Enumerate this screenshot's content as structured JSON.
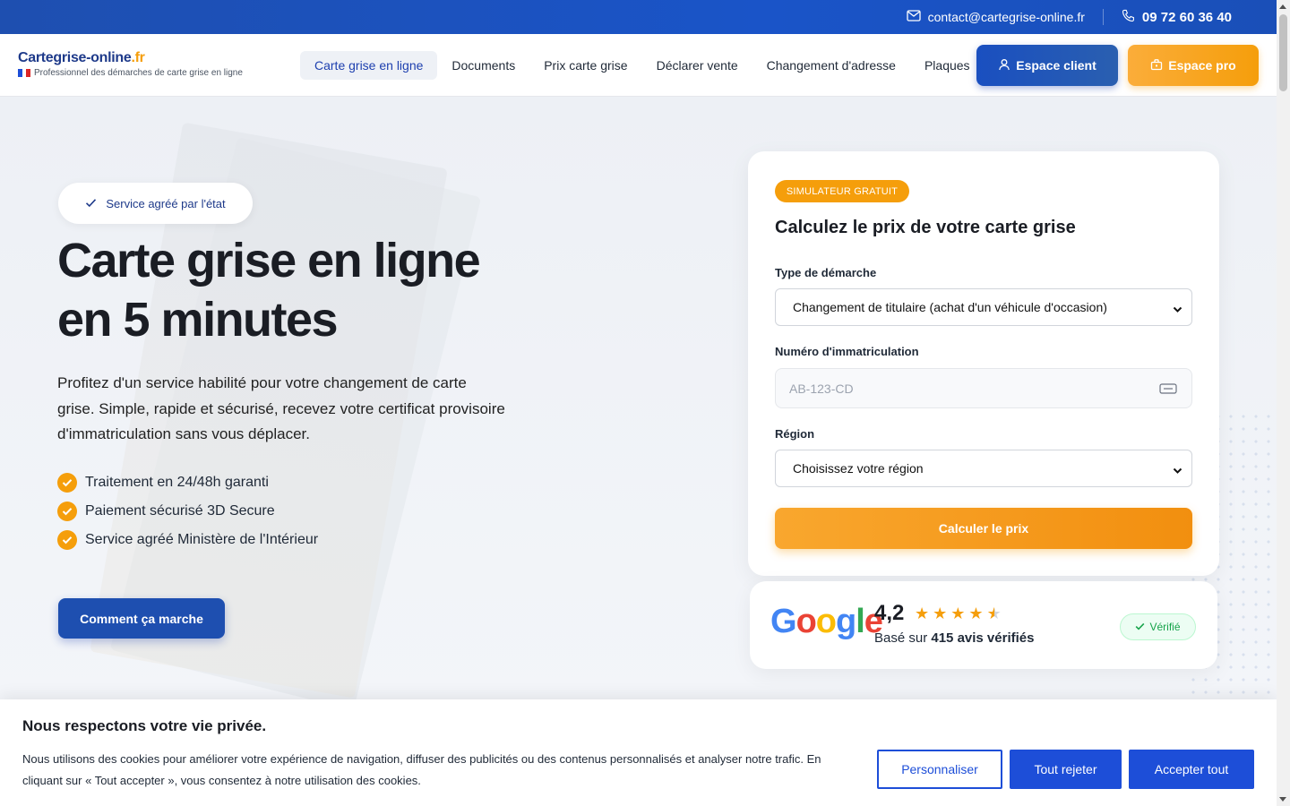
{
  "topbar": {
    "email": "contact@cartegrise-online.fr",
    "phone": "09 72 60 36 40",
    "email_icon": "envelope-icon",
    "phone_icon": "phone-icon"
  },
  "header": {
    "logo_name": "Cartegrise-online",
    "logo_tld": ".fr",
    "logo_tagline": "Professionnel des démarches de carte grise en ligne",
    "nav": [
      {
        "label": "Carte grise en ligne",
        "active": true
      },
      {
        "label": "Documents",
        "active": false
      },
      {
        "label": "Prix carte grise",
        "active": false
      },
      {
        "label": "Déclarer vente",
        "active": false
      },
      {
        "label": "Changement d'adresse",
        "active": false
      },
      {
        "label": "Plaques",
        "active": false
      }
    ],
    "client_button": "Espace client",
    "pro_button": "Espace pro"
  },
  "hero": {
    "badge": "Service agréé par l'état",
    "title_line1": "Carte grise en ligne",
    "title_line2": "en 5 minutes",
    "description": "Profitez d'un service habilité pour votre changement de carte grise. Simple, rapide et sécurisé, recevez votre certificat provisoire d'immatriculation sans vous déplacer.",
    "checks": [
      "Traitement en 24/48h garanti",
      "Paiement sécurisé 3D Secure",
      "Service agréé Ministère de l'Intérieur"
    ],
    "cta": "Comment ça marche"
  },
  "simulator": {
    "pill": "SIMULATEUR GRATUIT",
    "title": "Calculez le prix de votre carte grise",
    "type_label": "Type de démarche",
    "type_value": "Changement de titulaire (achat d'un véhicule d'occasion)",
    "plate_label": "Numéro d'immatriculation",
    "plate_placeholder": "AB-123-CD",
    "region_label": "Région",
    "region_value": "Choisissez votre région",
    "submit": "Calculer le prix"
  },
  "review": {
    "brand": "Google",
    "rating": "4,2",
    "stars": 4.5,
    "sub_prefix": "Basé sur ",
    "sub_count": "415 avis vérifiés",
    "verified": "Vérifié"
  },
  "cookie": {
    "title": "Nous respectons votre vie privée.",
    "text": "Nous utilisons des cookies pour améliorer votre expérience de navigation, diffuser des publicités ou des contenus personnalisés et analyser notre trafic. En cliquant sur « Tout accepter », vous consentez à notre utilisation des cookies.",
    "customize": "Personnaliser",
    "reject": "Tout rejeter",
    "accept": "Accepter tout"
  },
  "colors": {
    "primary_blue": "#1e4fb0",
    "accent_orange": "#f59e0b",
    "cookie_blue": "#1d4ed8"
  }
}
